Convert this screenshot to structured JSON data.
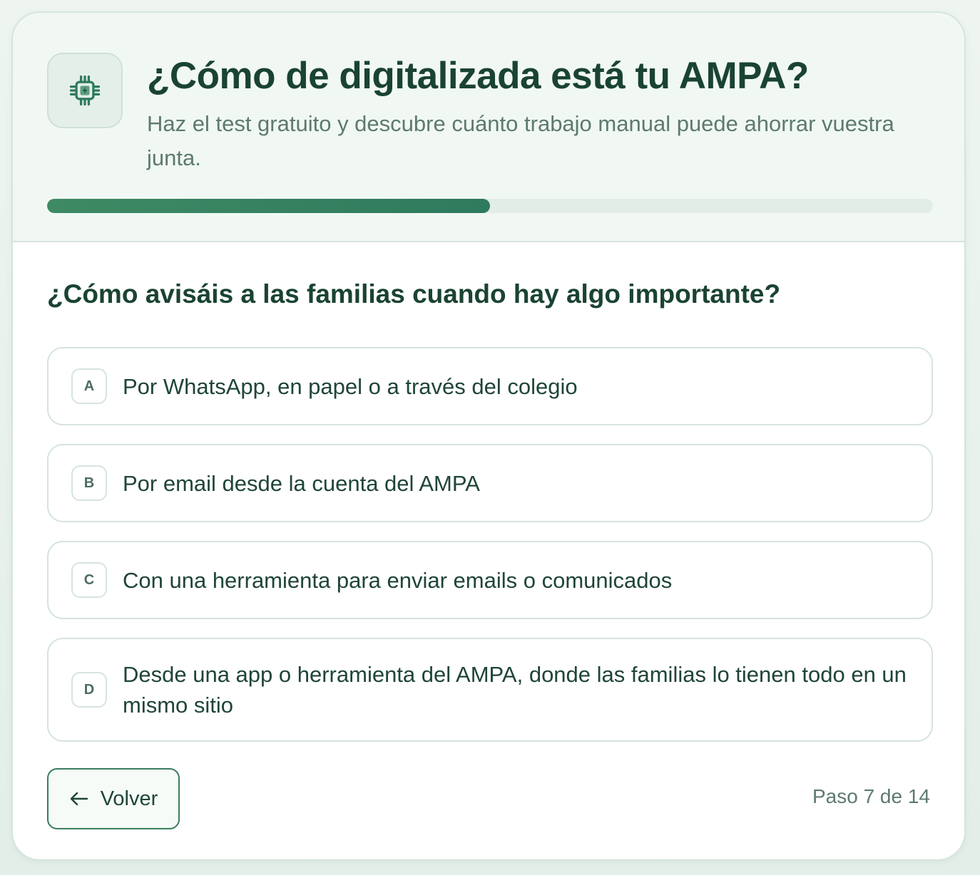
{
  "header": {
    "logo_icon": "chip-icon",
    "title": "¿Cómo de digitalizada está tu AMPA?",
    "subtitle": "Haz el test gratuito y descubre cuánto trabajo manual puede ahorrar vuestra junta.",
    "progress_fraction": 0.5
  },
  "question": {
    "text": "¿Cómo avisáis a las familias cuando hay algo importante?",
    "options": [
      {
        "letter": "A",
        "text": "Por WhatsApp, en papel o a través del colegio"
      },
      {
        "letter": "B",
        "text": "Por email desde la cuenta del AMPA"
      },
      {
        "letter": "C",
        "text": "Con una herramienta para enviar emails o comunicados"
      },
      {
        "letter": "D",
        "text": "Desde una app o herramienta del AMPA, donde las familias lo tienen todo en un mismo sitio"
      }
    ]
  },
  "footer": {
    "back_icon": "arrow-left-icon",
    "back_label": "Volver",
    "step_text": "Paso 7 de 14"
  },
  "colors": {
    "accent": "#2f7a5d",
    "title": "#1a4332",
    "muted": "#5d7a6e",
    "border": "#d6e4dd",
    "header_bg": "#f1f8f4"
  }
}
